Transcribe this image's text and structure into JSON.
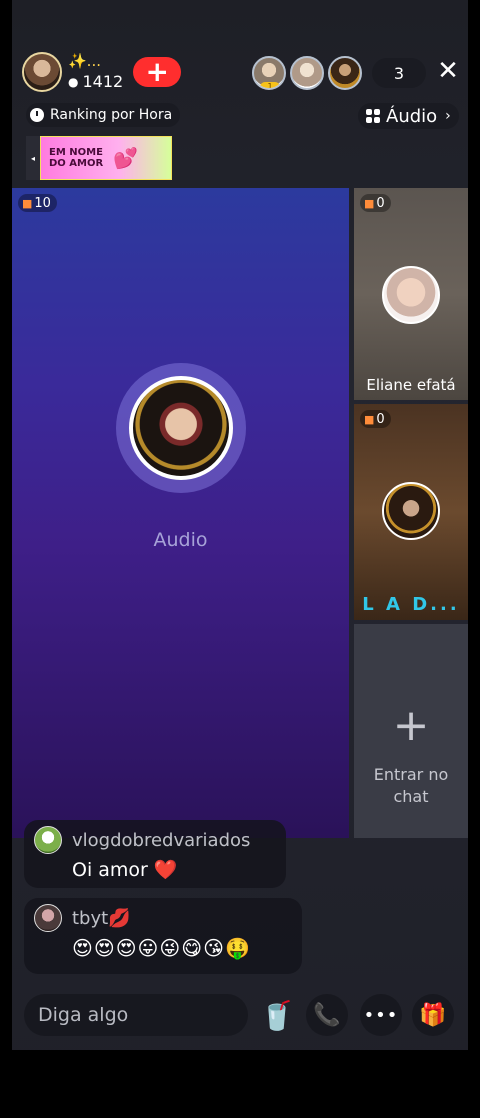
{
  "header": {
    "host_name": "✨...",
    "host_score": "1412",
    "follow_label": "+",
    "viewer_count": "3",
    "viewer_rank_1": "1",
    "close_label": "✕"
  },
  "subheader": {
    "ranking_label": "Ranking por Hora",
    "mode_label": "Áudio",
    "mode_chevron": "›",
    "banner_arrow": "◂",
    "banner_text": "EM NOME DO AMOR",
    "banner_hearts": "💕"
  },
  "stage": {
    "main_gift_count": "10",
    "main_label": "Audio",
    "slots": [
      {
        "gift_count": "0",
        "name": "Eliane efatá"
      },
      {
        "gift_count": "0",
        "name": "L A D..."
      },
      {
        "join_icon": "+",
        "join_label": "Entrar no chat"
      }
    ]
  },
  "chat": [
    {
      "user": "vlogdobredvariados",
      "text": "Oi amor ❤️"
    },
    {
      "user": "tbyt💋",
      "text": "😍😍😍😛😜😋😘🤑"
    }
  ],
  "bottom_bar": {
    "input_placeholder": "Diga algo",
    "drink_icon": "🥤",
    "call_icon": "📞",
    "more_icon": "•••",
    "gift_icon": "🎁"
  },
  "icons": {
    "flame": "flame-icon",
    "clock": "clock-icon",
    "grid": "grid-icon",
    "gift_badge": "gift-icon"
  },
  "colors": {
    "follow_red": "#ff2e2e",
    "host_gold": "#ffd34d",
    "stage_top": "#2c3a9e",
    "stage_bottom": "#2a1259",
    "slot_name_cyan": "#31c7e8"
  }
}
